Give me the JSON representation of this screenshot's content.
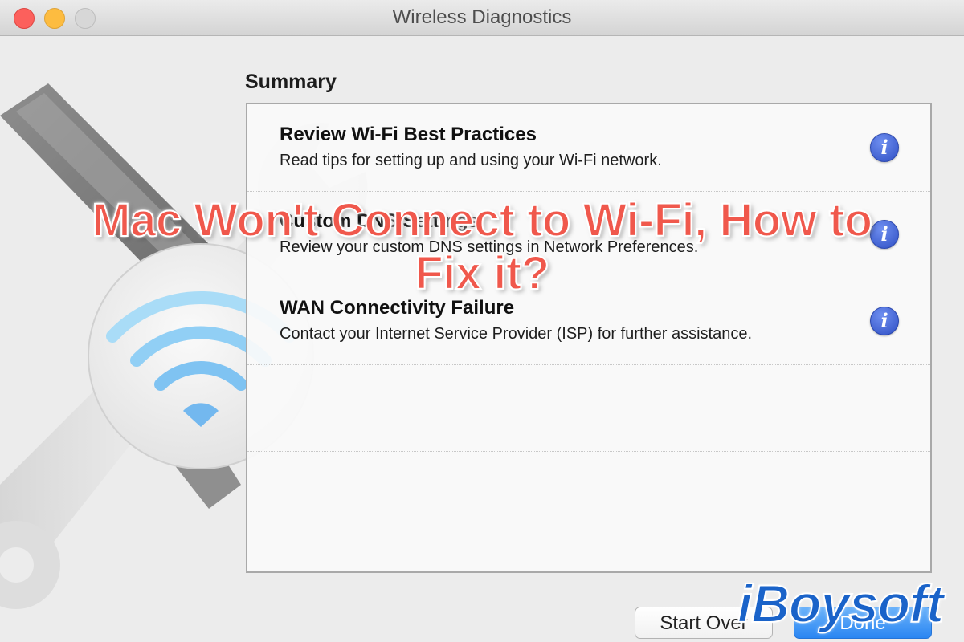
{
  "window": {
    "title": "Wireless Diagnostics"
  },
  "summary": {
    "heading": "Summary",
    "items": [
      {
        "title": "Review Wi-Fi Best Practices",
        "description": "Read tips for setting up and using your Wi-Fi network.",
        "icon": "info-icon"
      },
      {
        "title": "Custom DNS Settings",
        "description": "Review your custom DNS settings in Network Preferences.",
        "icon": "info-icon"
      },
      {
        "title": "WAN Connectivity Failure",
        "description": "Contact your Internet Service Provider (ISP) for further assistance.",
        "icon": "info-icon"
      }
    ]
  },
  "buttons": {
    "start_over": "Start Over",
    "done": "Done"
  },
  "overlay": {
    "line1": "Mac Won't Connect to Wi-Fi, How to",
    "line2": "Fix it?"
  },
  "logo": "iBoysoft",
  "colors": {
    "overlay_text": "#f0584c",
    "logo": "#1a63c9",
    "info_icon": "#3d5bd6",
    "done_button": "#2a86f2"
  }
}
